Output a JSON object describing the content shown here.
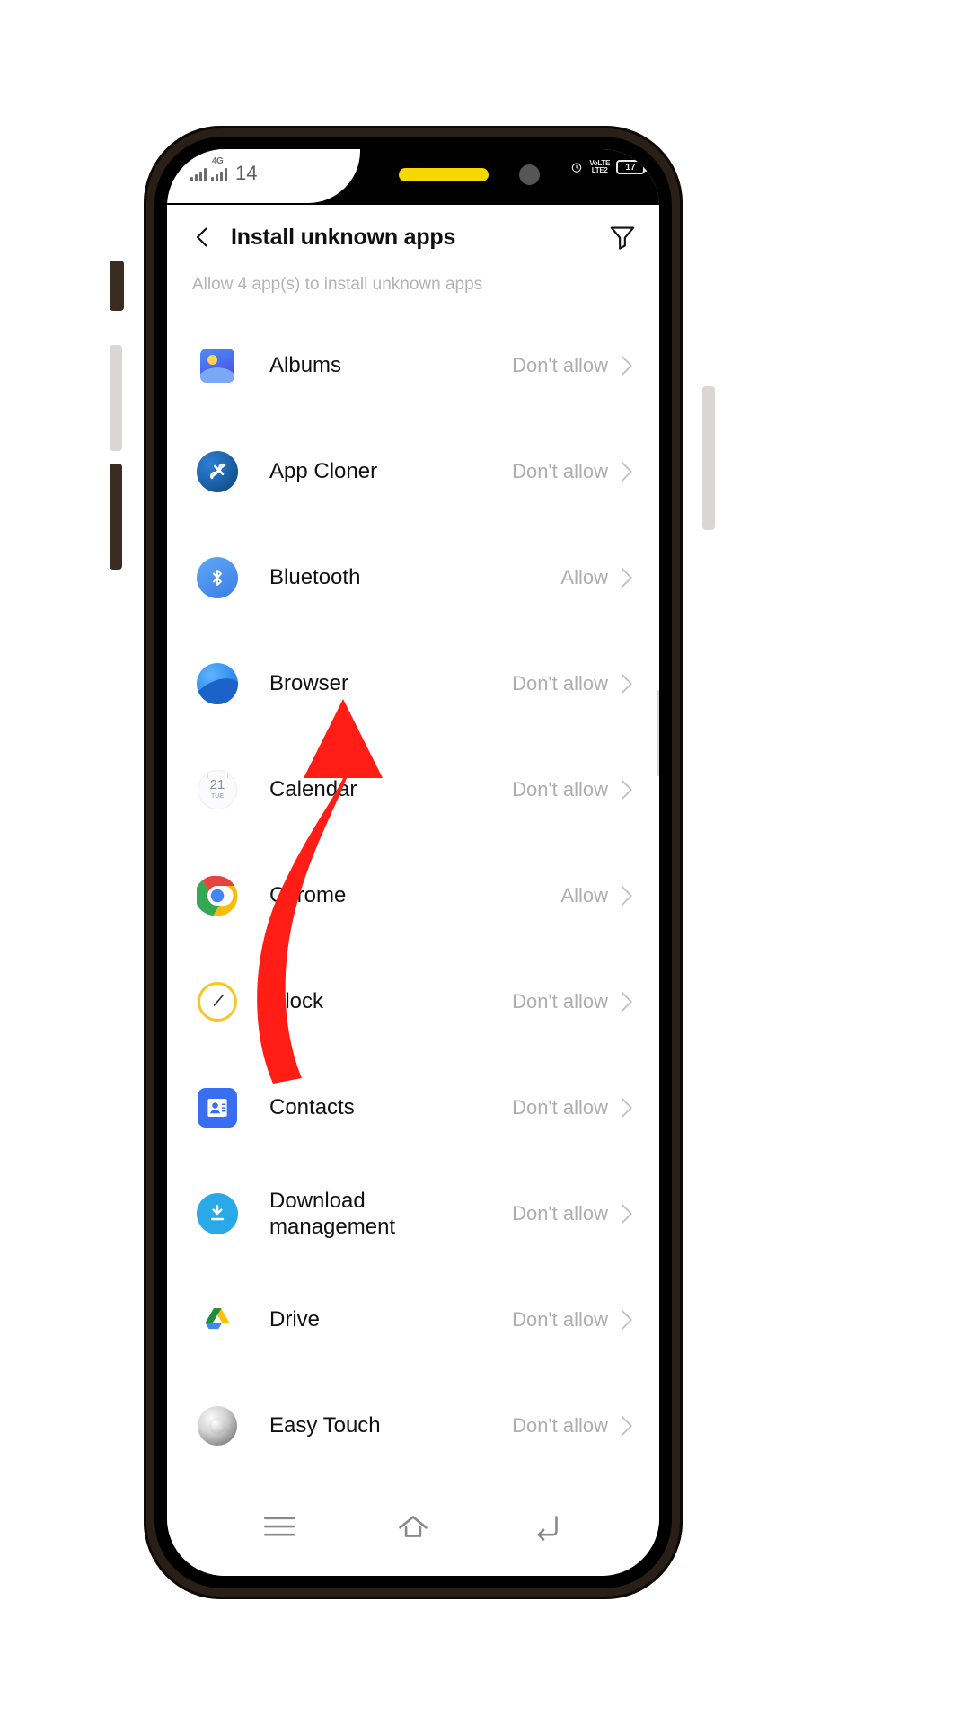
{
  "status_bar": {
    "network_label": "4G",
    "time": "14",
    "volte_line1": "VoLTE",
    "volte_line2": "LTE2",
    "battery_text": "17",
    "alarm_icon": "alarm-icon"
  },
  "header": {
    "back_icon": "back-chevron-icon",
    "title": "Install unknown apps",
    "filter_icon": "filter-icon"
  },
  "subtitle": "Allow 4 app(s) to install unknown apps",
  "chevron_icon": "chevron-right-icon",
  "apps": [
    {
      "name": "Albums",
      "state": "Don't allow",
      "icon": "albums-icon"
    },
    {
      "name": "App Cloner",
      "state": "Don't allow",
      "icon": "app-cloner-icon"
    },
    {
      "name": "Bluetooth",
      "state": "Allow",
      "icon": "bluetooth-icon"
    },
    {
      "name": "Browser",
      "state": "Don't allow",
      "icon": "browser-icon"
    },
    {
      "name": "Calendar",
      "state": "Don't allow",
      "icon": "calendar-icon"
    },
    {
      "name": "Chrome",
      "state": "Allow",
      "icon": "chrome-icon"
    },
    {
      "name": "Clock",
      "state": "Don't allow",
      "icon": "clock-icon"
    },
    {
      "name": "Contacts",
      "state": "Don't allow",
      "icon": "contacts-icon"
    },
    {
      "name": "Download management",
      "state": "Don't allow",
      "icon": "download-icon"
    },
    {
      "name": "Drive",
      "state": "Don't allow",
      "icon": "drive-icon"
    },
    {
      "name": "Easy Touch",
      "state": "Don't allow",
      "icon": "easy-touch-icon"
    }
  ],
  "calendar_icon": {
    "day": "21",
    "weekday": "TUE"
  },
  "navbar": {
    "recents_icon": "menu-recents-icon",
    "home_icon": "home-icon",
    "back_icon": "back-arrow-icon"
  },
  "annotation": {
    "arrow_icon": "red-arrow-annotation",
    "color": "#FF1D15"
  },
  "colors": {
    "accent_yellow": "#F5D800",
    "text_primary": "#111111",
    "text_secondary": "#AEAEAE",
    "subtitle": "#B3B3B3"
  }
}
